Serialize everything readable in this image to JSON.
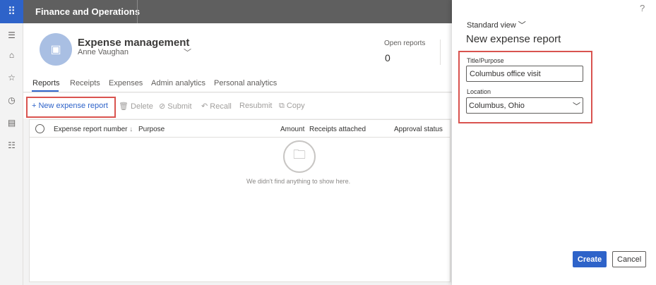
{
  "app": {
    "title": "Finance and Operations",
    "waffle_icon": "waffle-icon"
  },
  "leftnav": {
    "icons": [
      "hamburger-icon",
      "home-icon",
      "star-icon",
      "clock-icon",
      "workspace-icon",
      "list-icon"
    ]
  },
  "workspace": {
    "name": "Expense management",
    "user": "Anne Vaughan",
    "open_reports_label": "Open reports",
    "open_reports_value": "0"
  },
  "tabs": [
    "Reports",
    "Receipts",
    "Expenses",
    "Admin analytics",
    "Personal analytics"
  ],
  "toolbar": {
    "new_label": "New expense report",
    "delete_label": "Delete",
    "submit_label": "Submit",
    "recall_label": "Recall",
    "resubmit_label": "Resubmit",
    "copy_label": "Copy"
  },
  "grid": {
    "columns": [
      "Expense report number",
      "Purpose",
      "Amount",
      "Receipts attached",
      "Approval status"
    ],
    "empty_message": "We didn't find anything to show here."
  },
  "panel": {
    "help": "?",
    "view_selector": "Standard view",
    "title": "New expense report",
    "title_label": "Title/Purpose",
    "title_value": "Columbus office visit",
    "location_label": "Location",
    "location_value": "Columbus, Ohio",
    "create_label": "Create",
    "cancel_label": "Cancel"
  },
  "colors": {
    "accent": "#2e63c9",
    "topbar": "#5f5f5f",
    "highlight": "#d9534f"
  }
}
